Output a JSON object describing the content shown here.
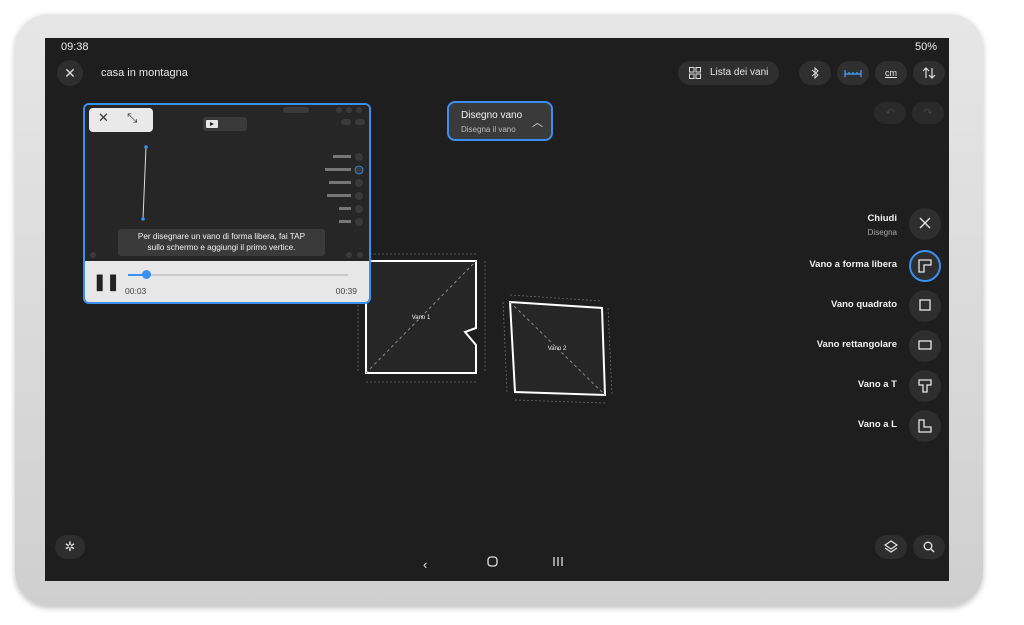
{
  "status": {
    "time": "09:38",
    "battery": "50%"
  },
  "header": {
    "title": "casa in montagna",
    "rooms_list_label": "Lista dei vani",
    "unit_label": "cm"
  },
  "draw_chip": {
    "title": "Disegno vano",
    "subtitle": "Disegna il vano"
  },
  "tools": {
    "close": {
      "label": "Chiudi",
      "sub": "Disegna"
    },
    "items": [
      {
        "label": "Vano a forma libera",
        "icon": "freeform-room-icon",
        "active": true
      },
      {
        "label": "Vano quadrato",
        "icon": "square-room-icon",
        "active": false
      },
      {
        "label": "Vano rettangolare",
        "icon": "rectangle-room-icon",
        "active": false
      },
      {
        "label": "Vano a T",
        "icon": "t-room-icon",
        "active": false
      },
      {
        "label": "Vano a L",
        "icon": "l-room-icon",
        "active": false
      }
    ]
  },
  "video": {
    "caption_line1": "Per disegnare un vano di forma libera, fai TAP",
    "caption_line2": "sullo schermo e aggiungi il primo vertice.",
    "current_time": "00:03",
    "total_time": "00:39",
    "progress": 0.08
  },
  "rooms": [
    {
      "name": "Vano 1"
    },
    {
      "name": "Vano 2"
    }
  ],
  "colors": {
    "accent": "#3b8ff0",
    "background": "#1e1e1e",
    "button": "#2e2e2e"
  }
}
